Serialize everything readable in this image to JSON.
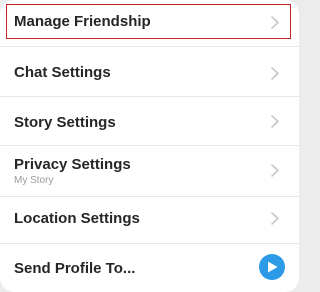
{
  "menu": {
    "items": [
      {
        "label": "Manage Friendship",
        "sublabel": ""
      },
      {
        "label": "Chat Settings",
        "sublabel": ""
      },
      {
        "label": "Story Settings",
        "sublabel": ""
      },
      {
        "label": "Privacy Settings",
        "sublabel": "My Story"
      },
      {
        "label": "Location Settings",
        "sublabel": ""
      },
      {
        "label": "Send Profile To...",
        "sublabel": ""
      }
    ],
    "chevron_icon": "chevron-right-icon",
    "send_icon": "play-send-icon"
  },
  "colors": {
    "highlight": "#c92424",
    "send_button": "#2d9ae8",
    "chevron": "#c8c8c8",
    "text": "#262626",
    "subtext": "#9a9a9a"
  }
}
